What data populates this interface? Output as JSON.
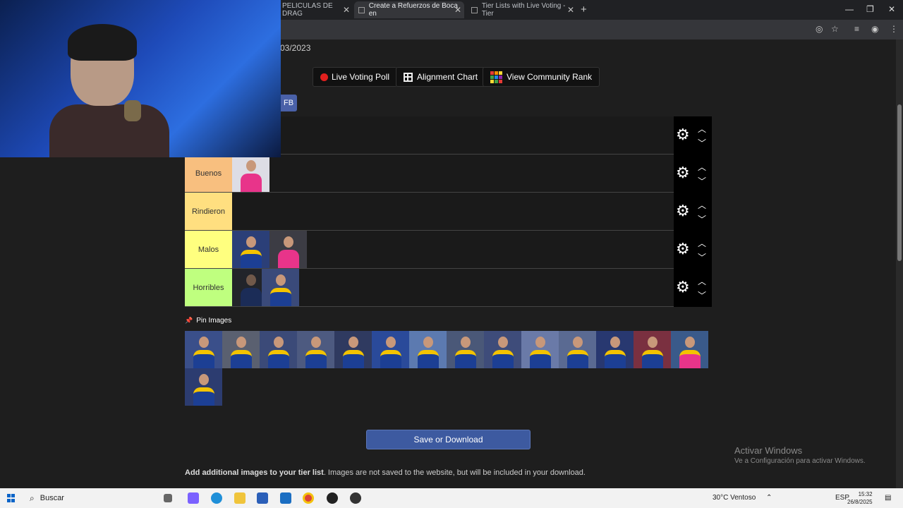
{
  "browser": {
    "tabs": [
      {
        "label": "PELICULAS DE DRAG",
        "active": false
      },
      {
        "label": "Create a Refuerzos de Boca en",
        "active": true
      },
      {
        "label": "Tier Lists with Live Voting - Tier",
        "active": false
      }
    ],
    "new_tab": "+",
    "win_min": "—",
    "win_max": "❐",
    "win_close": "✕"
  },
  "page": {
    "date": "03/2023",
    "buttons": {
      "live_voting": "Live Voting Poll",
      "alignment_chart": "Alignment Chart",
      "community_rank": "View Community Rank",
      "fb": "FB"
    },
    "tiers": [
      {
        "label": "",
        "color": "#1a1a1a",
        "items": []
      },
      {
        "label": "Buenos",
        "color": "#f8bf7f",
        "items": [
          "pink"
        ]
      },
      {
        "label": "Rindieron",
        "color": "#ffdf80",
        "items": []
      },
      {
        "label": "Malos",
        "color": "#ffff7f",
        "items": [
          "blue",
          "pink"
        ]
      },
      {
        "label": "Horribles",
        "color": "#bfff7f",
        "items": [
          "blue",
          "blue"
        ]
      }
    ],
    "pin_label": "Pin Images",
    "pool_count": 15,
    "save_button": "Save or Download",
    "add_text_bold": "Add additional images to your tier list",
    "add_text_rest": ". Images are not saved to the website, but will be included in your download."
  },
  "watermark": {
    "title": "Activar Windows",
    "subtitle": "Ve a Configuración para activar Windows."
  },
  "taskbar": {
    "search_placeholder": "Buscar",
    "weather": "30°C  Ventoso",
    "lang": "ESP",
    "time": "15:32",
    "date": "26/8/2025"
  },
  "colors": {
    "accent_blue": "#3d5aa0",
    "boca_blue": "#1c3f94",
    "boca_yellow": "#f3c300",
    "pink_jersey": "#e8348a"
  }
}
